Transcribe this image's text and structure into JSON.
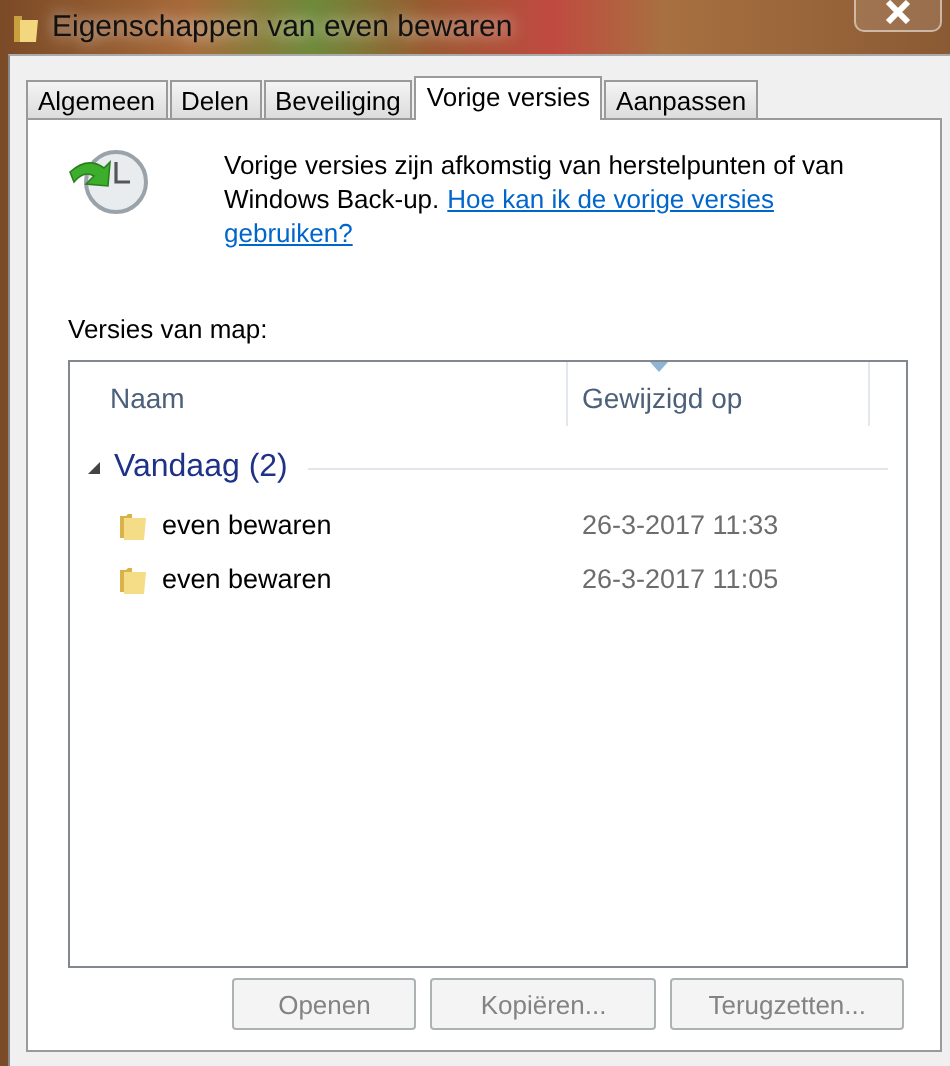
{
  "window": {
    "title": "Eigenschappen van even bewaren"
  },
  "tabs": [
    {
      "label": "Algemeen",
      "selected": false
    },
    {
      "label": "Delen",
      "selected": false
    },
    {
      "label": "Beveiliging",
      "selected": false
    },
    {
      "label": "Vorige versies",
      "selected": true
    },
    {
      "label": "Aanpassen",
      "selected": false
    }
  ],
  "info": {
    "text_lines": [
      "Vorige versies zijn afkomstig van herstelpunten of van",
      "Windows Back-up."
    ],
    "link_lines": [
      "Hoe kan ik de vorige versies",
      "gebruiken?"
    ]
  },
  "versions_label": "Versies van map:",
  "table": {
    "columns": [
      "Naam",
      "Gewijzigd op"
    ],
    "groups": [
      {
        "label": "Vandaag (2)",
        "expanded": true,
        "rows": [
          {
            "name": "even bewaren",
            "modified": "26-3-2017 11:33"
          },
          {
            "name": "even bewaren",
            "modified": "26-3-2017 11:05"
          }
        ]
      }
    ]
  },
  "buttons": [
    {
      "label": "Openen",
      "disabled": true
    },
    {
      "label": "Kopiëren...",
      "disabled": true
    },
    {
      "label": "Terugzetten...",
      "disabled": true
    }
  ]
}
